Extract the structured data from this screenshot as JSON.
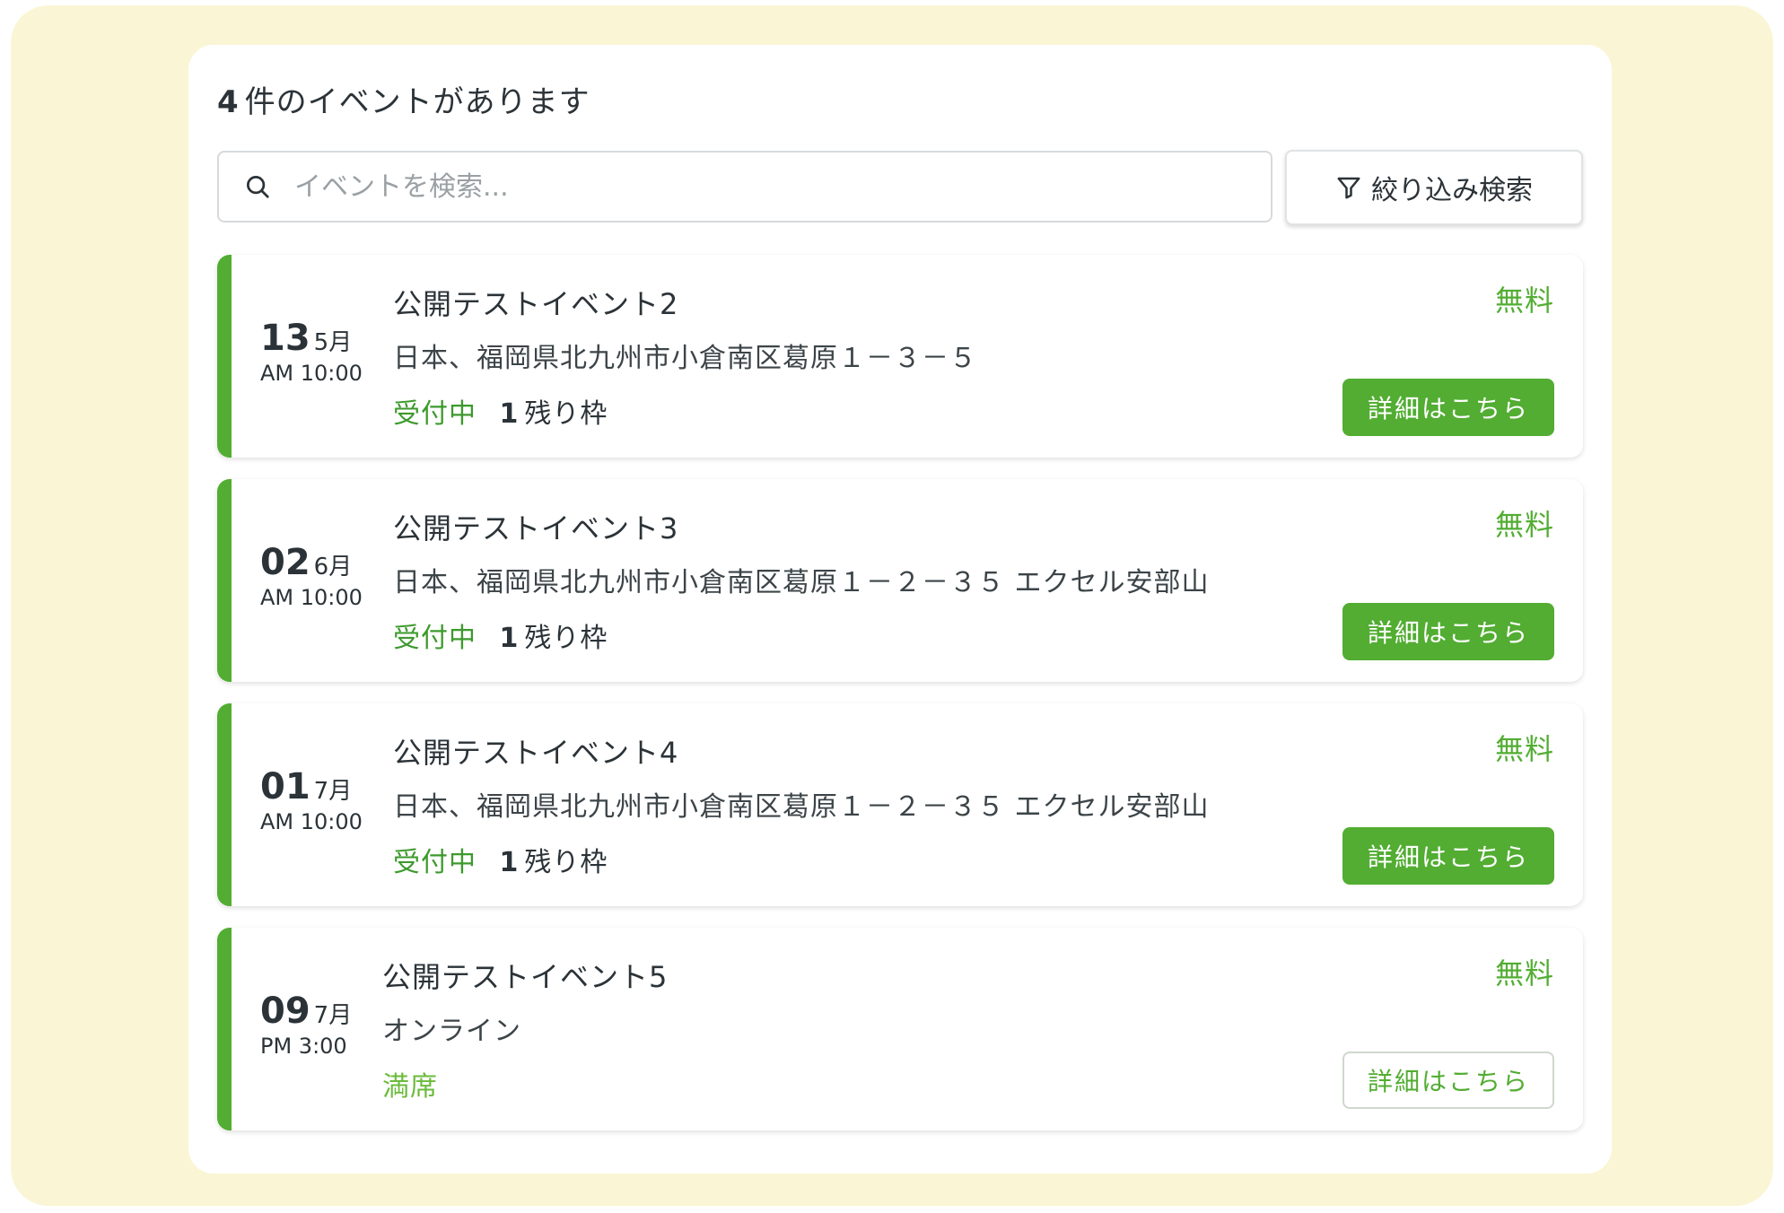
{
  "header": {
    "count": "4",
    "count_suffix": "件のイベントがあります"
  },
  "search": {
    "placeholder": "イベントを検索...",
    "icon": "search-icon"
  },
  "filter": {
    "label": "絞り込み検索",
    "icon": "filter-icon"
  },
  "colors": {
    "accent": "#52ad32",
    "background": "#faf6d5"
  },
  "events": [
    {
      "day": "13",
      "month": "5月",
      "time": "AM 10:00",
      "title": "公開テストイベント2",
      "location": "日本、福岡県北九州市小倉南区葛原１－３－５",
      "status": "受付中",
      "slots_count": "1",
      "slots_label": "残り枠",
      "price": "無料",
      "button": "詳細はこちら"
    },
    {
      "day": "02",
      "month": "6月",
      "time": "AM 10:00",
      "title": "公開テストイベント3",
      "location": "日本、福岡県北九州市小倉南区葛原１－２－３５ エクセル安部山",
      "status": "受付中",
      "slots_count": "1",
      "slots_label": "残り枠",
      "price": "無料",
      "button": "詳細はこちら"
    },
    {
      "day": "01",
      "month": "7月",
      "time": "AM 10:00",
      "title": "公開テストイベント4",
      "location": "日本、福岡県北九州市小倉南区葛原１－２－３５ エクセル安部山",
      "status": "受付中",
      "slots_count": "1",
      "slots_label": "残り枠",
      "price": "無料",
      "button": "詳細はこちら"
    },
    {
      "day": "09",
      "month": "7月",
      "time": "PM 3:00",
      "title": "公開テストイベント5",
      "location": "オンライン",
      "status": "満席",
      "price": "無料",
      "button": "詳細はこちら"
    }
  ]
}
